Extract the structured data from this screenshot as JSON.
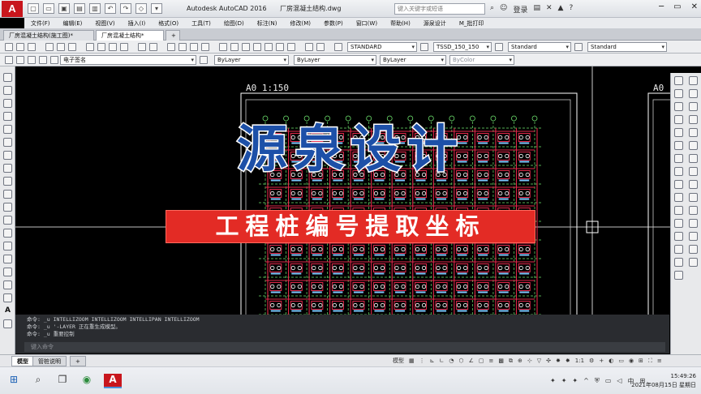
{
  "app": {
    "logo_letter": "A",
    "window_title": "Autodesk AutoCAD 2016",
    "file_title": "厂房混凝土结构.dwg",
    "search_placeholder": "键入关键字或短语",
    "login_label": "登录"
  },
  "menu": [
    "文件(F)",
    "编辑(E)",
    "视图(V)",
    "插入(I)",
    "格式(O)",
    "工具(T)",
    "绘图(D)",
    "标注(N)",
    "修改(M)",
    "参数(P)",
    "窗口(W)",
    "帮助(H)",
    "源泉设计",
    "M_批打印"
  ],
  "file_tabs": [
    {
      "label": "厂房混凝土结构(施工图)*",
      "active": false
    },
    {
      "label": "厂房混凝土结构*",
      "active": true
    },
    {
      "label": "+",
      "active": false
    }
  ],
  "toolbar1": {
    "text_style": "STANDARD",
    "dim_style": "TSSD_150_150",
    "table_style": "Standard",
    "multileader_style": "Standard"
  },
  "toolbar2": {
    "layer": "电子签名",
    "color": "ByLayer",
    "linetype": "ByLayer",
    "lineweight": "ByLayer",
    "plotstyle": "ByColor"
  },
  "drawing": {
    "sheet_label": "A0  1:150",
    "sheet_label_right": "A0"
  },
  "overlay": {
    "title": "源泉设计",
    "subtitle": "工程桩编号提取坐标"
  },
  "command_history": [
    "命令: _u INTELLIZOOM INTELLIZOOM INTELLIPAN INTELLIZOOM",
    "命令: _u '-LAYER 正在重生成模型。",
    "命令: _u 重要控制"
  ],
  "command_prompt": "键入命令",
  "layout_tabs": [
    {
      "label": "模型",
      "active": true
    },
    {
      "label": "管桩说明",
      "active": false
    },
    {
      "label": "+",
      "active": false
    }
  ],
  "status": {
    "model_label": "模型",
    "scale": "1:1"
  },
  "taskbar": {
    "time": "15:49:26",
    "date": "2021年08月15日 星期日",
    "ime": "中"
  },
  "colors": {
    "cad_red": "#c8161d",
    "banner_blue": "#1d50a8",
    "banner_red": "#e32b25",
    "pile_red": "#e0284a",
    "grid_green": "#6ee36e"
  }
}
